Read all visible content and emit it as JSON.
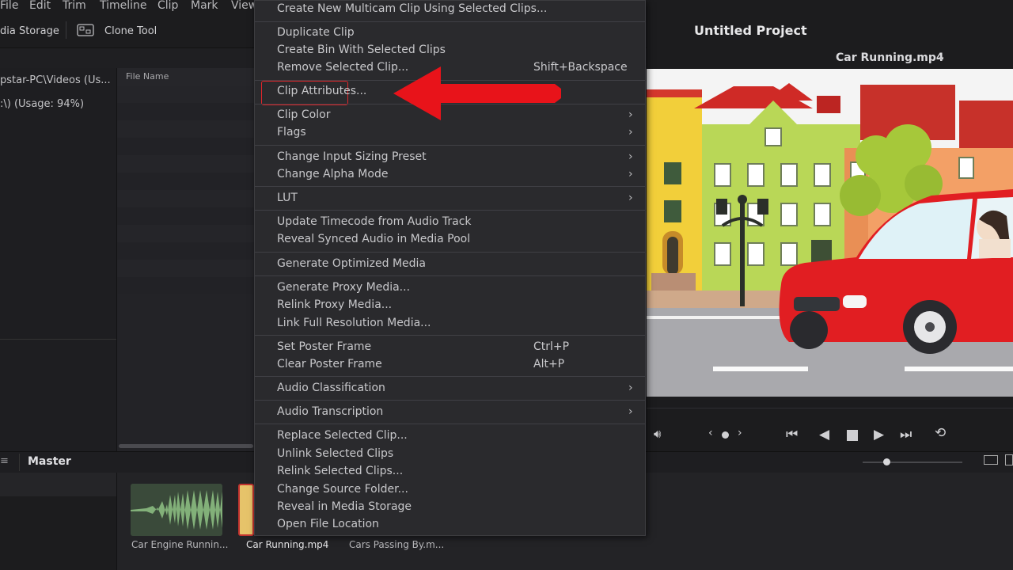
{
  "menubar": {
    "items": [
      "File",
      "Edit",
      "Trim",
      "Timeline",
      "Clip",
      "Mark",
      "View"
    ]
  },
  "toolbar": {
    "media_storage": "dia Storage",
    "clone_tool": "Clone Tool"
  },
  "project": {
    "title": "Untitled Project"
  },
  "storage": {
    "items": [
      "pstar-PC\\Videos (Us...",
      ":\\) (Usage: 94%)"
    ]
  },
  "filelist": {
    "header": "File Name"
  },
  "bin": {
    "title": "Master"
  },
  "viewer": {
    "clip_name": "Car Running.mp4"
  },
  "media_pool": {
    "clips": [
      {
        "label": "Car Engine Runnin..."
      },
      {
        "label": "Car Running.mp4"
      },
      {
        "label": "Cars Passing By.m..."
      }
    ]
  },
  "context_menu": {
    "items": [
      {
        "label": "Create New Multicam Clip Using Selected Clips...",
        "shortcut": ""
      },
      {
        "label": "Duplicate Clip",
        "shortcut": ""
      },
      {
        "label": "Create Bin With Selected Clips",
        "shortcut": ""
      },
      {
        "label": "Remove Selected Clip...",
        "shortcut": "Shift+Backspace"
      },
      {
        "label": "Clip Attributes...",
        "shortcut": ""
      },
      {
        "label": "Clip Color",
        "shortcut": ""
      },
      {
        "label": "Flags",
        "shortcut": ""
      },
      {
        "label": "Change Input Sizing Preset",
        "shortcut": ""
      },
      {
        "label": "Change Alpha Mode",
        "shortcut": ""
      },
      {
        "label": "LUT",
        "shortcut": ""
      },
      {
        "label": "Update Timecode from Audio Track",
        "shortcut": ""
      },
      {
        "label": "Reveal Synced Audio in Media Pool",
        "shortcut": ""
      },
      {
        "label": "Generate Optimized Media",
        "shortcut": ""
      },
      {
        "label": "Generate Proxy Media...",
        "shortcut": ""
      },
      {
        "label": "Relink Proxy Media...",
        "shortcut": ""
      },
      {
        "label": "Link Full Resolution Media...",
        "shortcut": ""
      },
      {
        "label": "Set Poster Frame",
        "shortcut": "Ctrl+P"
      },
      {
        "label": "Clear Poster Frame",
        "shortcut": "Alt+P"
      },
      {
        "label": "Audio Classification",
        "shortcut": ""
      },
      {
        "label": "Audio Transcription",
        "shortcut": ""
      },
      {
        "label": "Replace Selected Clip...",
        "shortcut": ""
      },
      {
        "label": "Unlink Selected Clips",
        "shortcut": ""
      },
      {
        "label": "Relink Selected Clips...",
        "shortcut": ""
      },
      {
        "label": "Change Source Folder...",
        "shortcut": ""
      },
      {
        "label": "Reveal in Media Storage",
        "shortcut": ""
      },
      {
        "label": "Open File Location",
        "shortcut": ""
      }
    ]
  },
  "colors": {
    "accent_red": "#e0262b",
    "menu_bg": "#2a2a2d",
    "app_bg": "#1f1f22"
  }
}
